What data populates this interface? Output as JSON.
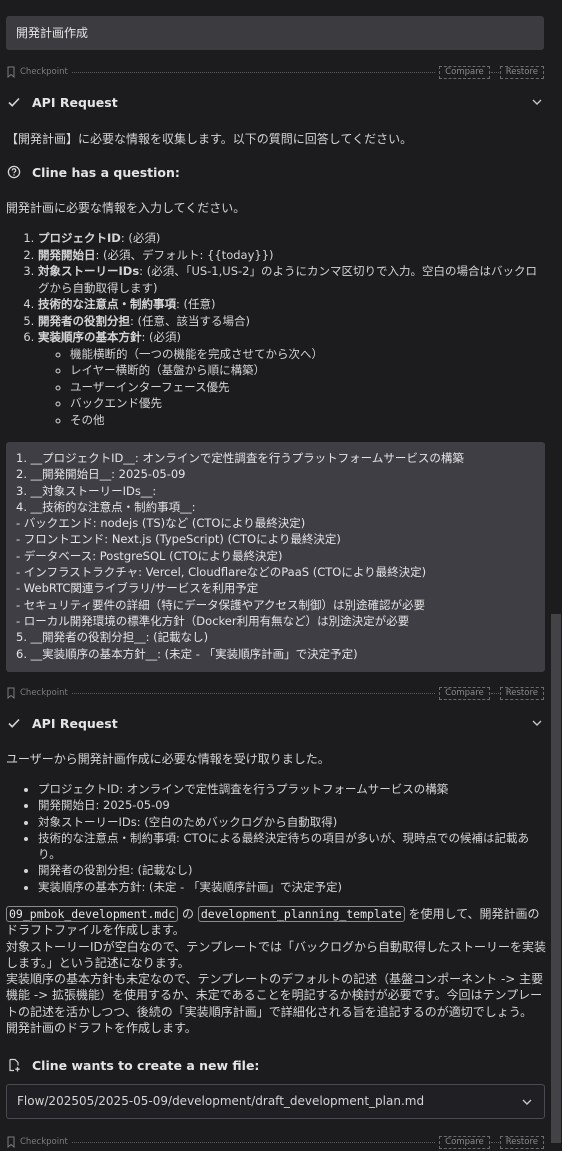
{
  "user_message": "開発計画作成",
  "checkpoint": {
    "label": "Checkpoint",
    "compare": "Compare",
    "restore": "Restore"
  },
  "api_request_1": {
    "title": "API Request",
    "text": "【開発計画】に必要な情報を収集します。以下の質問に回答してください。"
  },
  "question": {
    "title": "Cline has a question:",
    "intro": "開発計画に必要な情報を入力してください。",
    "items": [
      {
        "b": "プロジェクトID",
        "t": ": (必須)"
      },
      {
        "b": "開発開始日",
        "t": ": (必須、デフォルト: {{today}})"
      },
      {
        "b": "対象ストーリーIDs",
        "t": ": (必須、「US-1,US-2」のようにカンマ区切りで入力。空白の場合はバックログから自動取得します)"
      },
      {
        "b": "技術的な注意点・制約事項",
        "t": ": (任意)"
      },
      {
        "b": "開発者の役割分担",
        "t": ": (任意、該当する場合)"
      },
      {
        "b": "実装順序の基本方針",
        "t": ": (必須)"
      }
    ],
    "sub_items": [
      "機能横断的（一つの機能を完成させてから次へ）",
      "レイヤー横断的（基盤から順に構築）",
      "ユーザーインターフェース優先",
      "バックエンド優先",
      "その他"
    ]
  },
  "answer_lines": [
    "1. __プロジェクトID__: オンラインで定性調査を行うプラットフォームサービスの構築",
    "2. __開発開始日__: 2025-05-09",
    "3. __対象ストーリーIDs__:",
    "4. __技術的な注意点・制約事項__:",
    "- バックエンド: nodejs (TS)など (CTOにより最終決定)",
    "- フロントエンド: Next.js (TypeScript) (CTOにより最終決定)",
    "- データベース: PostgreSQL (CTOにより最終決定)",
    "- インフラストラクチャ: Vercel, CloudflareなどのPaaS (CTOにより最終決定)",
    "- WebRTC関連ライブラリ/サービスを利用予定",
    "- セキュリティ要件の詳細（特にデータ保護やアクセス制御）は別途確認が必要",
    "- ローカル開発環境の標準化方針（Docker利用有無など）は別途決定が必要",
    "5. __開発者の役割分担__: (記載なし)",
    "6. __実装順序の基本方針__: (未定 - 「実装順序計画」で決定予定)"
  ],
  "api_request_2": {
    "title": "API Request",
    "intro": "ユーザーから開発計画作成に必要な情報を受け取りました。",
    "summary": [
      "プロジェクトID: オンラインで定性調査を行うプラットフォームサービスの構築",
      "開発開始日: 2025-05-09",
      "対象ストーリーIDs: (空白のためバックログから自動取得)",
      "技術的な注意点・制約事項: CTOによる最終決定待ちの項目が多いが、現時点での候補は記載あり。",
      "開発者の役割分担: (記載なし)",
      "実装順序の基本方針: (未定 - 「実装順序計画」で決定予定)"
    ],
    "code1": "09_pmbok_development.mdc",
    "mid1": "の",
    "code2": "development_planning_template",
    "mid2": "を使用して、開発計画のドラフトファイルを作成します。",
    "p2": "対象ストーリーIDが空白なので、テンプレートでは「バックログから自動取得したストーリーを実装します。」という記述になります。",
    "p3": "実装順序の基本方針も未定なので、テンプレートのデフォルトの記述（基盤コンポーネント -> 主要機能 -> 拡張機能）を使用するか、未定であることを明記するか検討が必要です。今回はテンプレートの記述を活かしつつ、後続の「実装順序計画」で詳細化される旨を追記するのが適切でしょう。",
    "p4": "開発計画のドラフトを作成します。"
  },
  "new_file": {
    "title": "Cline wants to create a new file:",
    "path": "Flow/202505/2025-05-09/development/draft_development_plan.md"
  },
  "icons": [
    "bookmark-icon",
    "check-icon",
    "question-circle-icon",
    "new-file-icon",
    "chevron-down-icon"
  ]
}
